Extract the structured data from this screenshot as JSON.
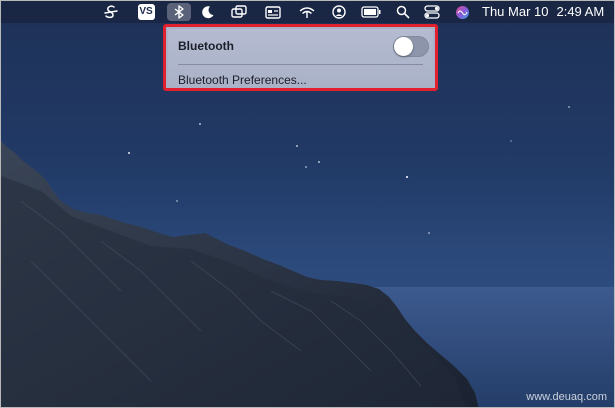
{
  "menubar": {
    "icons": [
      "script-s-icon",
      "vs-app-icon",
      "bluetooth-icon",
      "moon-icon",
      "windows-icon",
      "id-card-icon",
      "wifi-icon",
      "user-icon",
      "battery-icon",
      "search-icon",
      "control-center-icon",
      "siri-icon"
    ],
    "app_badge": "VS",
    "day_date": "Thu Mar 10",
    "time": "2:49 AM"
  },
  "dropdown": {
    "title": "Bluetooth",
    "toggle_state": "off",
    "preferences_label": "Bluetooth Preferences..."
  },
  "watermark": "www.deuaq.com",
  "colors": {
    "highlight_border": "#e0202c",
    "menu_background": "#aab2c8"
  }
}
